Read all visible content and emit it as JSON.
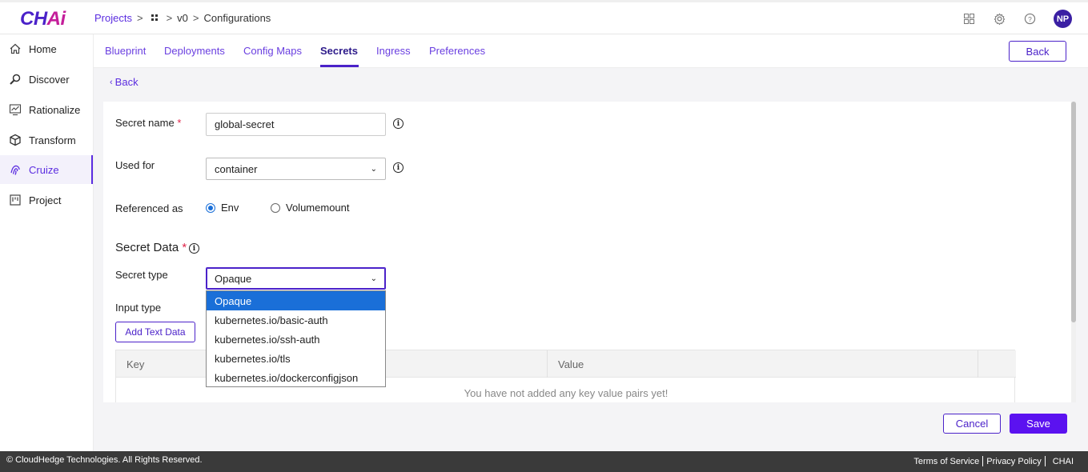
{
  "app": {
    "logo_main": "CH",
    "logo_accent": "Ai"
  },
  "breadcrumb": {
    "projects": "Projects",
    "version": "v0",
    "current": "Configurations"
  },
  "user": {
    "initials": "NP"
  },
  "sidebar": {
    "items": [
      {
        "label": "Home",
        "icon": "home-icon"
      },
      {
        "label": "Discover",
        "icon": "search-icon"
      },
      {
        "label": "Rationalize",
        "icon": "chart-icon"
      },
      {
        "label": "Transform",
        "icon": "cube-icon"
      },
      {
        "label": "Cruize",
        "icon": "fingerprint-icon"
      },
      {
        "label": "Project",
        "icon": "board-icon"
      }
    ],
    "active": "Cruize"
  },
  "tabs": {
    "items": [
      "Blueprint",
      "Deployments",
      "Config Maps",
      "Secrets",
      "Ingress",
      "Preferences"
    ],
    "active": "Secrets",
    "back_label": "Back"
  },
  "page": {
    "back_link": "Back"
  },
  "form": {
    "secret_name_label": "Secret name",
    "secret_name_value": "global-secret",
    "used_for_label": "Used for",
    "used_for_value": "container",
    "referenced_as_label": "Referenced as",
    "ref_options": [
      "Env",
      "Volumemount"
    ],
    "ref_selected": "Env",
    "secret_data_title": "Secret Data",
    "secret_type_label": "Secret type",
    "secret_type_value": "Opaque",
    "input_type_label": "Input type",
    "add_text_button": "Add Text Data",
    "required_mark": "*"
  },
  "secret_type_options": [
    "Opaque",
    "kubernetes.io/basic-auth",
    "kubernetes.io/ssh-auth",
    "kubernetes.io/tls",
    "kubernetes.io/dockerconfigjson"
  ],
  "table": {
    "headers": [
      "Key",
      "Value"
    ],
    "empty_text": "You have not added any key value pairs yet!"
  },
  "actions": {
    "cancel": "Cancel",
    "save": "Save"
  },
  "footer": {
    "copyright": "© CloudHedge Technologies. All Rights Reserved.",
    "links": [
      "Terms of Service",
      "Privacy Policy",
      "CHAI"
    ]
  },
  "colors": {
    "brand": "#4b22c9",
    "accent": "#c41e9a",
    "selected_option": "#1a6fd8",
    "save_button": "#5b12f0"
  }
}
